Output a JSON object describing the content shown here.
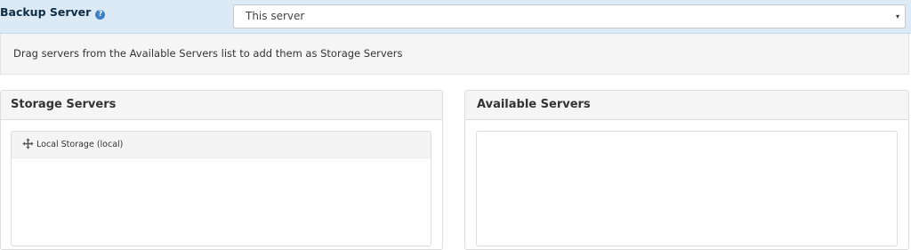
{
  "backup": {
    "label": "Backup Server",
    "help_icon": "?",
    "select_value": "This server",
    "caret": "▾"
  },
  "info": {
    "text": "Drag servers from the Available Servers list to add them as Storage Servers"
  },
  "storage_panel": {
    "title": "Storage Servers",
    "items": [
      {
        "label": "Local Storage (local)",
        "icon": "move-icon"
      }
    ]
  },
  "available_panel": {
    "title": "Available Servers",
    "items": []
  },
  "colors": {
    "header_band": "#dceaf5",
    "label_text": "#0d2c45",
    "help_icon": "#3f7fc6",
    "panel_heading_bg": "#f5f5f5",
    "border": "#dddddd"
  }
}
